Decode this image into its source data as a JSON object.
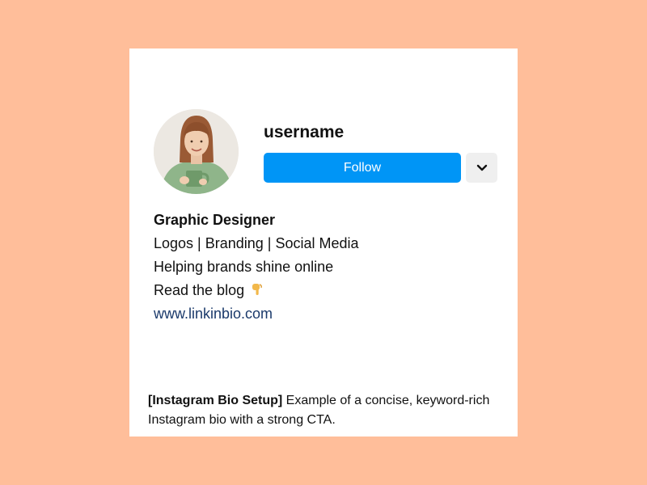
{
  "profile": {
    "username": "username",
    "follow_label": "Follow",
    "more_icon": "chevron-down-icon",
    "follow_color": "#0095F6"
  },
  "bio": {
    "title": "Graphic Designer",
    "line1": "Logos | Branding | Social Media",
    "line2": "Helping brands shine online",
    "line3": "Read the blog",
    "line3_emoji": "pointing-down-emoji",
    "link": "www.linkinbio.com"
  },
  "caption": {
    "tag": "[Instagram Bio Setup]",
    "text": " Example of a concise, keyword-rich Instagram bio with a strong CTA."
  },
  "colors": {
    "page_background": "#FFBE9A",
    "link": "#1b3a6b"
  }
}
